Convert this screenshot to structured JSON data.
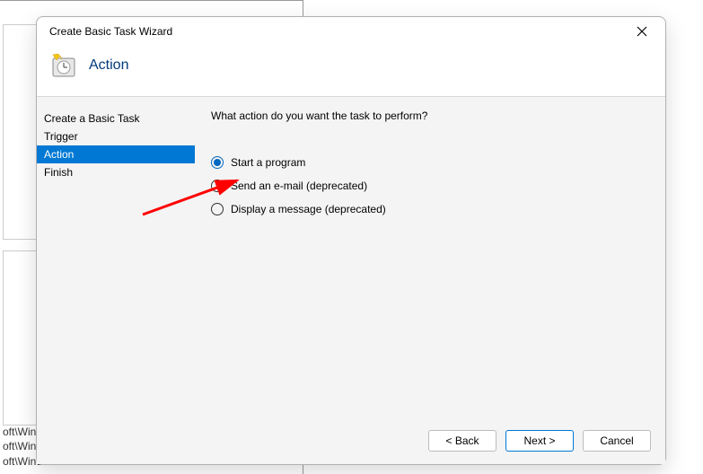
{
  "background": {
    "path1": "oft\\Wind…",
    "path2": "oft\\Windows\\U…",
    "path3": "oft\\Windows\\Fli…"
  },
  "dialog": {
    "title": "Create Basic Task Wizard",
    "header_title": "Action",
    "sidebar": {
      "items": [
        {
          "label": "Create a Basic Task",
          "active": false
        },
        {
          "label": "Trigger",
          "active": false
        },
        {
          "label": "Action",
          "active": true
        },
        {
          "label": "Finish",
          "active": false
        }
      ]
    },
    "prompt": "What action do you want the task to perform?",
    "options": [
      {
        "label": "Start a program",
        "selected": true
      },
      {
        "label": "Send an e-mail (deprecated)",
        "selected": false
      },
      {
        "label": "Display a message (deprecated)",
        "selected": false
      }
    ],
    "buttons": {
      "back": "< Back",
      "next": "Next >",
      "cancel": "Cancel"
    }
  }
}
